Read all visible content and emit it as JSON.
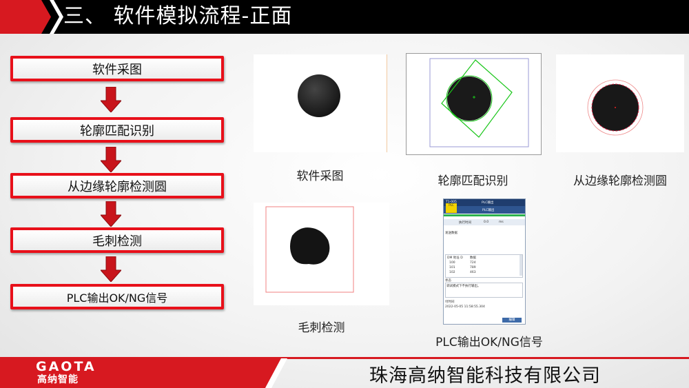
{
  "header": {
    "title": "三、 软件模拟流程-正面"
  },
  "flow": {
    "steps": [
      "软件采图",
      "轮廓匹配识别",
      "从边缘轮廓检测圆",
      "毛刺检测",
      "PLC输出OK/NG信号"
    ]
  },
  "images": {
    "captions": [
      "软件采图",
      "轮廓匹配识别",
      "从边缘轮廓检测圆",
      "毛刺检测",
      "PLC输出OK/NG信号"
    ]
  },
  "plc_window": {
    "title": "T1-005",
    "window_name": "PLC输出",
    "panel_name": "PLC输出",
    "badge": "PLC",
    "exec_label": "执行时间",
    "exec_value": "0.0",
    "exec_unit": "ms",
    "send_label": "发送数据",
    "table_headers": [
      "DM 地址 D",
      "数据"
    ],
    "table_rows": [
      [
        "100",
        "724"
      ],
      [
        "101",
        "789"
      ],
      [
        "102",
        "463"
      ]
    ],
    "status_label": "状态",
    "status_text": "调试模式下不执行输出。",
    "time_label": "付时间",
    "time_value": "2022-05-05 11:58:55.304",
    "edit_button": "编辑"
  },
  "footer": {
    "logo": "GAOTA",
    "logo_cn": "高纳智能",
    "company": "珠海高纳智能科技有限公司"
  },
  "colors": {
    "accent": "#d71920",
    "header_bg": "#000000",
    "box_border": "#e8101a"
  }
}
